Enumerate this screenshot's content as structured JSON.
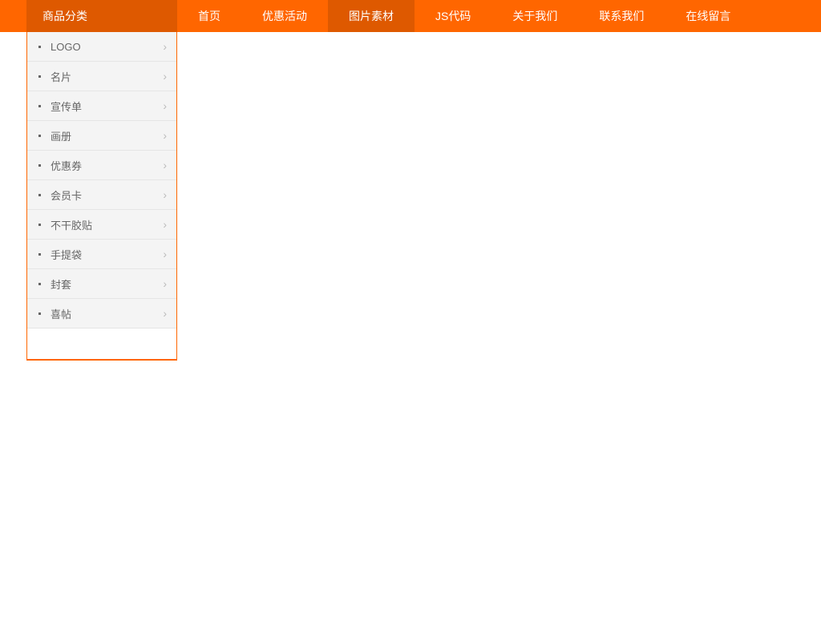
{
  "sidebar_header": "商品分类",
  "nav": {
    "items": [
      {
        "label": "首页",
        "active": false
      },
      {
        "label": "优惠活动",
        "active": false
      },
      {
        "label": "图片素材",
        "active": true
      },
      {
        "label": "JS代码",
        "active": false
      },
      {
        "label": "关于我们",
        "active": false
      },
      {
        "label": "联系我们",
        "active": false
      },
      {
        "label": "在线留言",
        "active": false
      }
    ]
  },
  "sidebar": {
    "items": [
      {
        "label": "LOGO"
      },
      {
        "label": "名片"
      },
      {
        "label": "宣传单"
      },
      {
        "label": "画册"
      },
      {
        "label": "优惠券"
      },
      {
        "label": "会员卡"
      },
      {
        "label": "不干胶贴"
      },
      {
        "label": "手提袋"
      },
      {
        "label": "封套"
      },
      {
        "label": "喜帖"
      }
    ]
  }
}
